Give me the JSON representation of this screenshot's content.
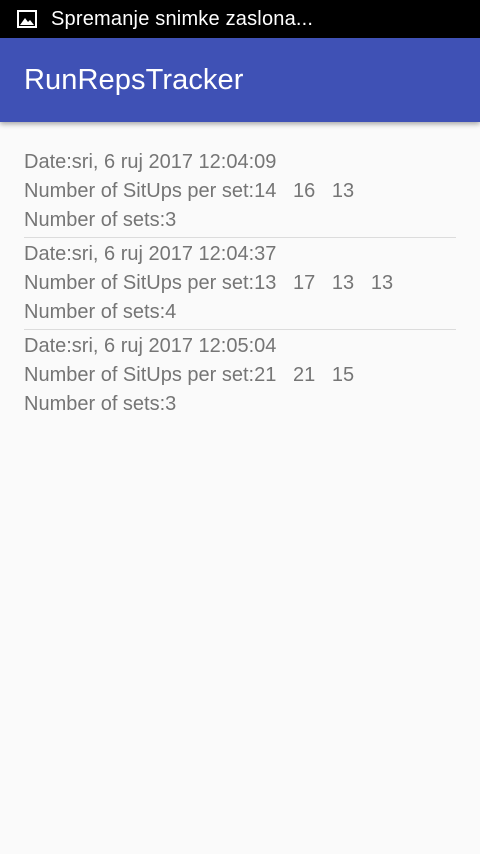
{
  "status_bar": {
    "icon": "image-icon",
    "text": "Spremanje snimke zaslona..."
  },
  "app_bar": {
    "title": "RunRepsTracker"
  },
  "entries": [
    {
      "date": "Date:sri, 6 ruj 2017 12:04:09",
      "situps": "Number of SitUps per set:14   16   13",
      "sets": "Number of sets:3"
    },
    {
      "date": "Date:sri, 6 ruj 2017 12:04:37",
      "situps": "Number of SitUps per set:13   17   13   13",
      "sets": "Number of sets:4"
    },
    {
      "date": "Date:sri, 6 ruj 2017 12:05:04",
      "situps": "Number of SitUps per set:21   21   15",
      "sets": "Number of sets:3"
    }
  ]
}
